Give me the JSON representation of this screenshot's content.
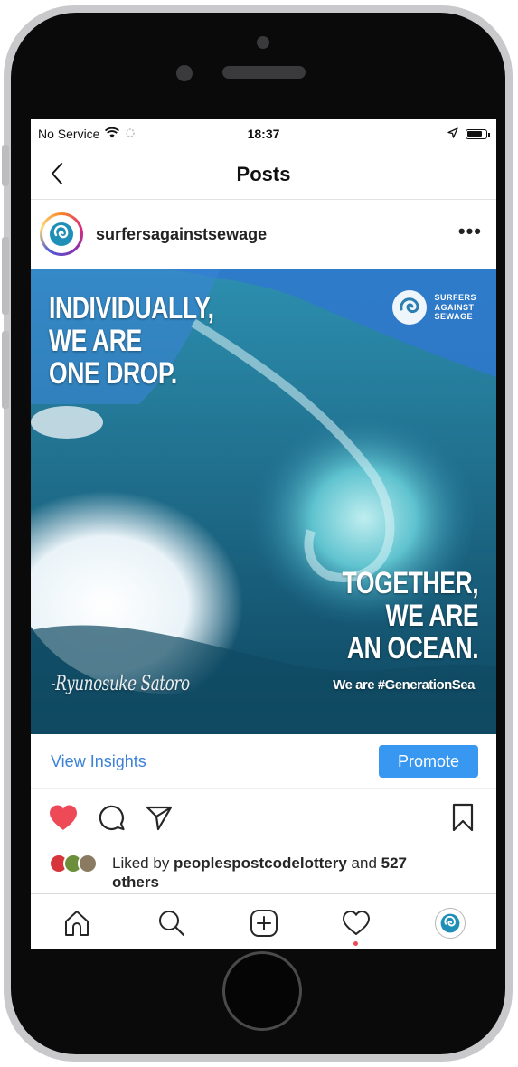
{
  "status_bar": {
    "carrier": "No Service",
    "time": "18:37"
  },
  "nav": {
    "title": "Posts"
  },
  "post": {
    "username": "surfersagainstsewage",
    "more_label": "•••",
    "image": {
      "quote_top": [
        "INDIVIDUALLY,",
        "WE ARE",
        "ONE DROP."
      ],
      "quote_bottom": [
        "TOGETHER,",
        "WE ARE",
        "AN OCEAN."
      ],
      "author": "-Ryunosuke Satoro",
      "hashtag": "We are #GenerationSea",
      "logo_text": [
        "SURFERS",
        "AGAINST",
        "SEWAGE"
      ]
    }
  },
  "insights": {
    "view_label": "View Insights",
    "promote_label": "Promote"
  },
  "likes": {
    "prefix": "Liked by ",
    "user": "peoplespostcodelottery",
    "joiner": " and ",
    "count": "527",
    "suffix": "others"
  },
  "colors": {
    "heart": "#ed4956",
    "promote": "#3897f0",
    "link": "#3b82d8"
  },
  "tabs": [
    "home-icon",
    "search-icon",
    "new-post-icon",
    "activity-icon",
    "profile-icon"
  ]
}
